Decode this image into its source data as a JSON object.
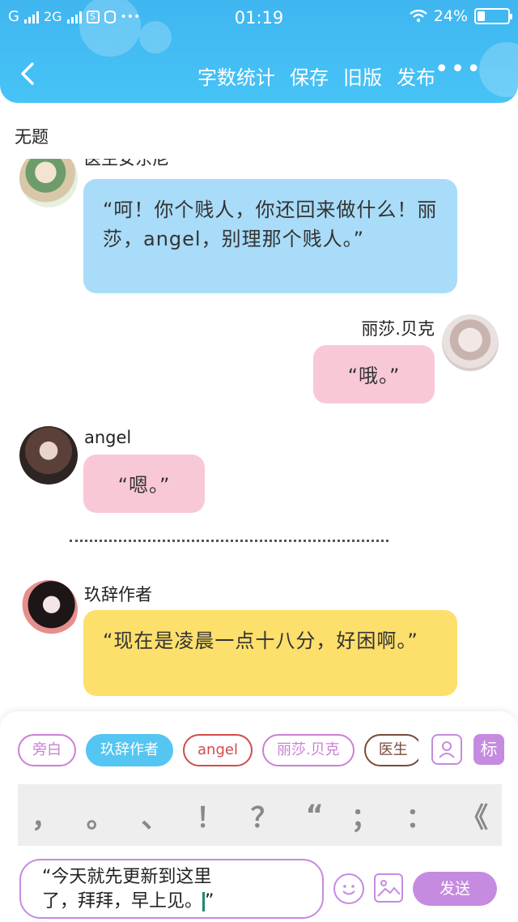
{
  "status_bar": {
    "carrier1": "G",
    "carrier2": "2G",
    "more": "•••",
    "time": "01:19",
    "battery": "24%",
    "battery_level": 0.24
  },
  "topbar": {
    "actions": [
      "字数统计",
      "保存",
      "旧版",
      "发布"
    ],
    "more": "•••"
  },
  "document": {
    "title": "无题"
  },
  "messages": [
    {
      "name": "医生安东尼",
      "text": "“呵！你个贱人，你还回来做什么！丽莎，angel，别理那个贱人。”",
      "color": "#a9dcf8"
    },
    {
      "name": "丽莎.贝克",
      "text": "“哦。”",
      "color": "#f9c8d6"
    },
    {
      "name": "angel",
      "text": "“嗯。”",
      "color": "#f9c8d6"
    },
    {
      "name": "玖辞作者",
      "text": "“现在是凌晨一点十八分，好困啊。”",
      "color": "#fddf6c"
    }
  ],
  "separator": "·····································",
  "panel": {
    "roles": [
      "旁白",
      "玖辞作者",
      "angel",
      "丽莎.贝克",
      "医生"
    ],
    "mark_label": "标",
    "punctuation": [
      "，",
      "。",
      "、",
      "！",
      "？",
      "“",
      "；",
      "：",
      "《"
    ],
    "input_text_line1": "“今天就先更新到这里",
    "input_text_line2": "了，拜拜，早上见。",
    "input_text_end": "”",
    "send_label": "发送"
  },
  "colors": {
    "header": "#45bff4",
    "accent": "#c58be0"
  }
}
